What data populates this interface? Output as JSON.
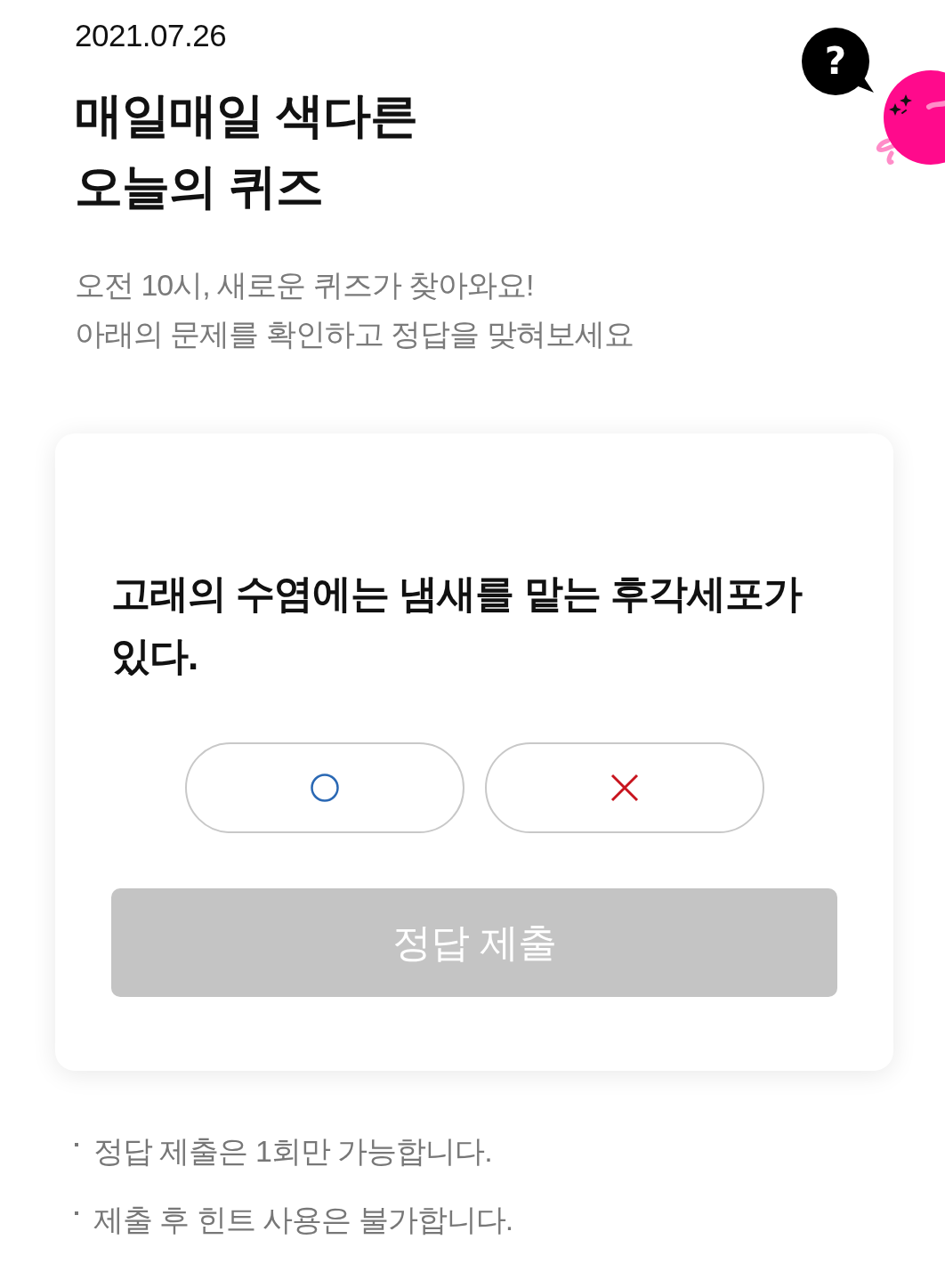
{
  "header": {
    "date": "2021.07.26",
    "title_lines": [
      "매일매일 색다른",
      "오늘의 퀴즈"
    ],
    "bubble": "?"
  },
  "intro": [
    "오전 10시, 새로운 퀴즈가 찾아와요!",
    "아래의 문제를 확인하고 정답을 맞혀보세요"
  ],
  "quiz": {
    "question": "고래의 수염에는 냄새를 맡는 후각세포가 있다.",
    "options": [
      {
        "kind": "o",
        "selected": false
      },
      {
        "kind": "x",
        "selected": false
      }
    ],
    "submit": {
      "label": "정답 제출",
      "disabled": true
    }
  },
  "notes": [
    "정답 제출은 1회만 가능합니다.",
    "제출 후 힌트 사용은 불가합니다."
  ]
}
